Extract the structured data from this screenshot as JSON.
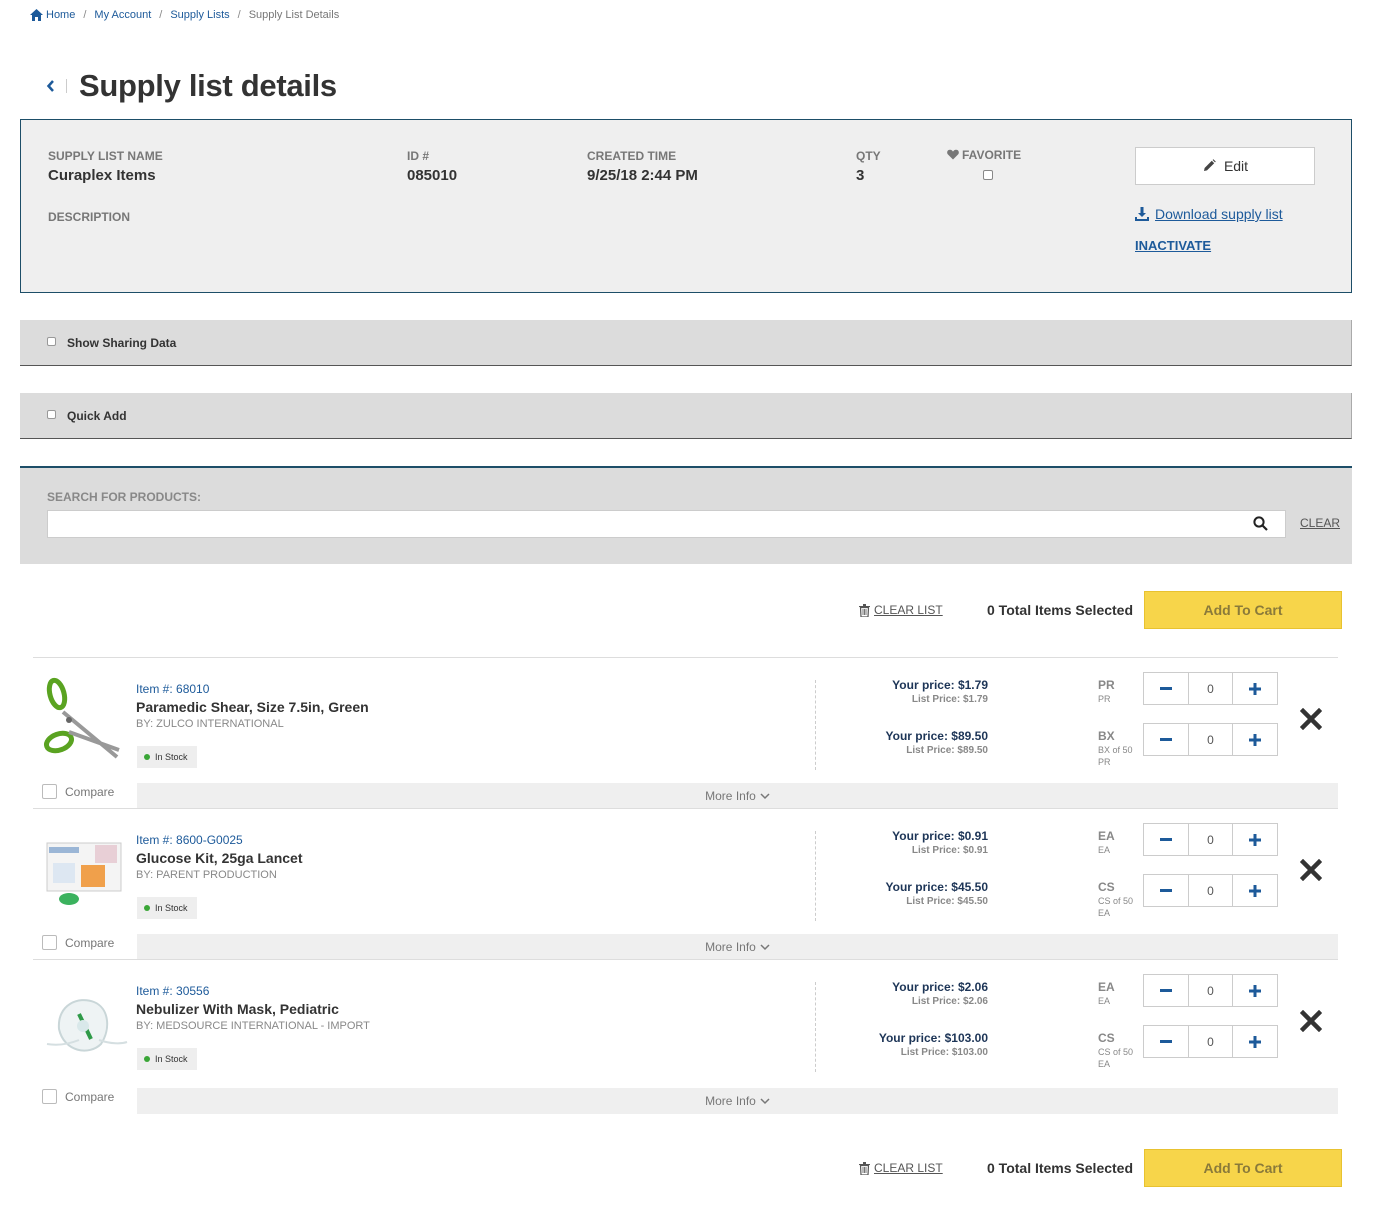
{
  "breadcrumb": {
    "home": "Home",
    "my_account": "My Account",
    "supply_lists": "Supply Lists",
    "current": "Supply List Details",
    "sep": "/"
  },
  "page": {
    "title": "Supply list details"
  },
  "info": {
    "name_label": "SUPPLY LIST NAME",
    "name_value": "Curaplex Items",
    "id_label": "ID #",
    "id_value": "085010",
    "created_label": "CREATED TIME",
    "created_value": "9/25/18 2:44 PM",
    "qty_label": "QTY",
    "qty_value": "3",
    "favorite_label": "FAVORITE",
    "description_label": "DESCRIPTION",
    "edit_label": "Edit",
    "download_label": "Download supply list",
    "inactivate_label": "INACTIVATE"
  },
  "toggles": {
    "sharing": "Show Sharing Data",
    "quick_add": "Quick Add"
  },
  "search": {
    "label": "SEARCH FOR PRODUCTS:",
    "value": "",
    "clear": "CLEAR"
  },
  "actions": {
    "clear_list": "CLEAR LIST",
    "total_selected": "0 Total Items Selected",
    "add_to_cart": "Add To Cart"
  },
  "products": [
    {
      "item": "Item #: 68010",
      "name": "Paramedic Shear, Size 7.5in, Green",
      "by": "By: ZULCO INTERNATIONAL",
      "stock": "In Stock",
      "compare": "Compare",
      "more": "More Info",
      "prices": [
        {
          "your": "Your price: $1.79",
          "list": "List Price: $1.79",
          "uom": "PR",
          "uom_sub": "PR",
          "uom_sub2": "",
          "qty": "0"
        },
        {
          "your": "Your price: $89.50",
          "list": "List Price: $89.50",
          "uom": "BX",
          "uom_sub": "BX of 50",
          "uom_sub2": "PR",
          "qty": "0"
        }
      ]
    },
    {
      "item": "Item #: 8600-G0025",
      "name": "Glucose Kit, 25ga Lancet",
      "by": "By: PARENT PRODUCTION",
      "stock": "In Stock",
      "compare": "Compare",
      "more": "More Info",
      "prices": [
        {
          "your": "Your price: $0.91",
          "list": "List Price: $0.91",
          "uom": "EA",
          "uom_sub": "EA",
          "uom_sub2": "",
          "qty": "0"
        },
        {
          "your": "Your price: $45.50",
          "list": "List Price: $45.50",
          "uom": "CS",
          "uom_sub": "CS of 50",
          "uom_sub2": "EA",
          "qty": "0"
        }
      ]
    },
    {
      "item": "Item #: 30556",
      "name": "Nebulizer With Mask, Pediatric",
      "by": "By: MEDSOURCE INTERNATIONAL - IMPORT",
      "stock": "In Stock",
      "compare": "Compare",
      "more": "More Info",
      "prices": [
        {
          "your": "Your price: $2.06",
          "list": "List Price: $2.06",
          "uom": "EA",
          "uom_sub": "EA",
          "uom_sub2": "",
          "qty": "0"
        },
        {
          "your": "Your price: $103.00",
          "list": "List Price: $103.00",
          "uom": "CS",
          "uom_sub": "CS of 50",
          "uom_sub2": "EA",
          "qty": "0"
        }
      ]
    }
  ],
  "colors": {
    "link": "#1d5a9a",
    "accent_border": "#1d4e68",
    "add_to_cart_bg": "#f7d54a",
    "in_stock_dot": "#3aa637"
  }
}
